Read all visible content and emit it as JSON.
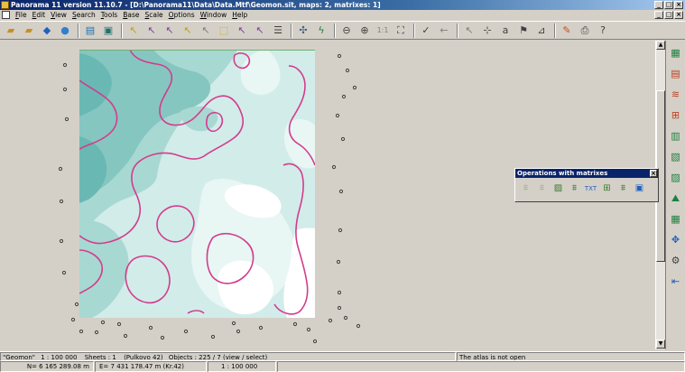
{
  "window": {
    "title": "Panorama 11 version 11.10.7 - [D:\\Panorama11\\Data\\Data.Mtf\\Geomon.sit, maps: 2, matrixes: 1]",
    "controls": [
      "_",
      "□",
      "×"
    ]
  },
  "menu": {
    "items": [
      "File",
      "Edit",
      "View",
      "Search",
      "Tools",
      "Base",
      "Scale",
      "Options",
      "Window",
      "Help"
    ],
    "mdi_controls": [
      "_",
      "□",
      "×"
    ]
  },
  "toolbar": {
    "zoom_ratio_label": "1:1",
    "icons": [
      "open-folder-icon",
      "open-file-icon",
      "connect-icon",
      "globe-icon",
      "layers-icon",
      "save-icon",
      "select-icon",
      "select-objects-icon",
      "select-frame-icon",
      "select-area-icon",
      "deselect-icon",
      "rectangle-select-icon",
      "select-by-type-icon",
      "select-list-icon",
      "properties-icon",
      "map-tools-icon",
      "lightning-icon",
      "zoom-out-icon",
      "zoom-in-icon",
      "full-view-icon",
      "check-icon",
      "back-icon",
      "pointer-icon",
      "add-point-icon",
      "text-icon",
      "label-icon",
      "measure-icon",
      "clear-icon",
      "print-icon",
      "help-icon"
    ]
  },
  "ops_panel": {
    "title": "Operations with matrixes",
    "close": "×",
    "tools": [
      "matrix-build-icon",
      "matrix-profile-icon",
      "matrix-export-icon",
      "matrix-filter-icon",
      "matrix-to-text-icon",
      "matrix-height-icon",
      "matrix-edit-icon",
      "matrix-paint-icon"
    ],
    "txt_label": "TXT"
  },
  "status": {
    "map_name": "\"Geomon\"",
    "scale": "1 : 100 000",
    "sheets": "Sheets : 1",
    "datum": "(Pulkovo 42)",
    "objects": "Objects : 225 / 7 (view / select)",
    "atlas": "The atlas is not open",
    "north": "N= 6 165 289.08 m",
    "east": "E= 7 431 178.47 m  (Kr.42)",
    "current_scale": "1 : 100 000"
  },
  "colors": {
    "contour": "#d23c8c",
    "dark_teal": "#6ab8b4",
    "mid_teal": "#a8d8d2",
    "light_teal": "#d2ecea",
    "title_bar": "#0a246a"
  }
}
